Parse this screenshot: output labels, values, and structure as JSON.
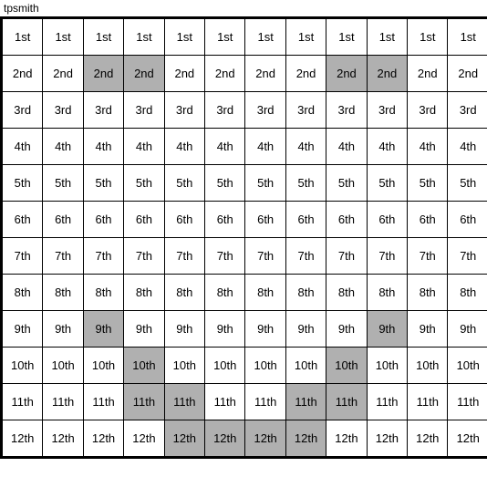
{
  "title": "tpsmith",
  "rows": [
    {
      "label": "1st",
      "highlights": [
        false,
        false,
        false,
        false,
        false,
        false,
        false,
        false,
        false,
        false,
        false,
        false
      ]
    },
    {
      "label": "2nd",
      "highlights": [
        false,
        false,
        true,
        true,
        false,
        false,
        false,
        false,
        true,
        true,
        false,
        false
      ]
    },
    {
      "label": "3rd",
      "highlights": [
        false,
        false,
        false,
        false,
        false,
        false,
        false,
        false,
        false,
        false,
        false,
        false
      ]
    },
    {
      "label": "4th",
      "highlights": [
        false,
        false,
        false,
        false,
        false,
        false,
        false,
        false,
        false,
        false,
        false,
        false
      ]
    },
    {
      "label": "5th",
      "highlights": [
        false,
        false,
        false,
        false,
        false,
        false,
        false,
        false,
        false,
        false,
        false,
        false
      ]
    },
    {
      "label": "6th",
      "highlights": [
        false,
        false,
        false,
        false,
        false,
        false,
        false,
        false,
        false,
        false,
        false,
        false
      ]
    },
    {
      "label": "7th",
      "highlights": [
        false,
        false,
        false,
        false,
        false,
        false,
        false,
        false,
        false,
        false,
        false,
        false
      ]
    },
    {
      "label": "8th",
      "highlights": [
        false,
        false,
        false,
        false,
        false,
        false,
        false,
        false,
        false,
        false,
        false,
        false
      ]
    },
    {
      "label": "9th",
      "highlights": [
        false,
        false,
        true,
        false,
        false,
        false,
        false,
        false,
        false,
        true,
        false,
        false
      ]
    },
    {
      "label": "10th",
      "highlights": [
        false,
        false,
        false,
        true,
        false,
        false,
        false,
        false,
        true,
        false,
        false,
        false
      ]
    },
    {
      "label": "11th",
      "highlights": [
        false,
        false,
        false,
        true,
        true,
        false,
        false,
        true,
        true,
        false,
        false,
        false
      ]
    },
    {
      "label": "12th",
      "highlights": [
        false,
        false,
        false,
        false,
        true,
        true,
        true,
        true,
        false,
        false,
        false,
        false
      ]
    }
  ],
  "cols": 12
}
